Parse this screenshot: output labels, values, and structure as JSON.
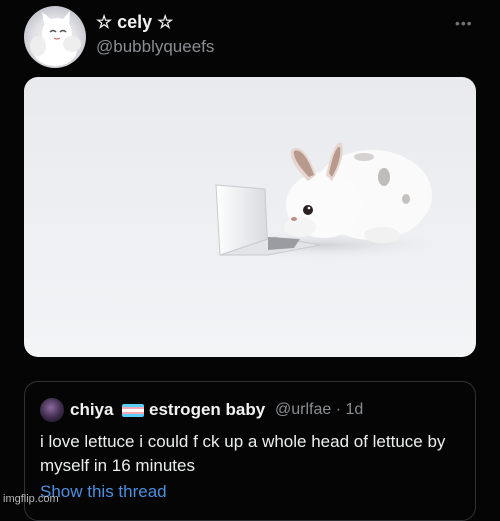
{
  "tweet": {
    "display_name": "☆ cely ☆",
    "handle": "@bubblyqueefs",
    "more_icon": "more-dots-icon"
  },
  "media": {
    "icon": "photo-bunny-with-laptop"
  },
  "quoted_tweet": {
    "name": "chiya",
    "flag": "transgender-flag-icon",
    "name_suffix": "estrogen baby",
    "handle_time": "@urlfae · 1d",
    "text": "i love lettuce i could f  ck up a whole head of lettuce by myself in 16 minutes",
    "link": "Show this thread"
  },
  "watermark": "imgflip.com",
  "colors": {
    "background": "#050505",
    "link": "#4a8fe0",
    "flag_blue": "#5BCEFA",
    "flag_pink": "#F5A9B8",
    "flag_white": "#FFFFFF"
  }
}
